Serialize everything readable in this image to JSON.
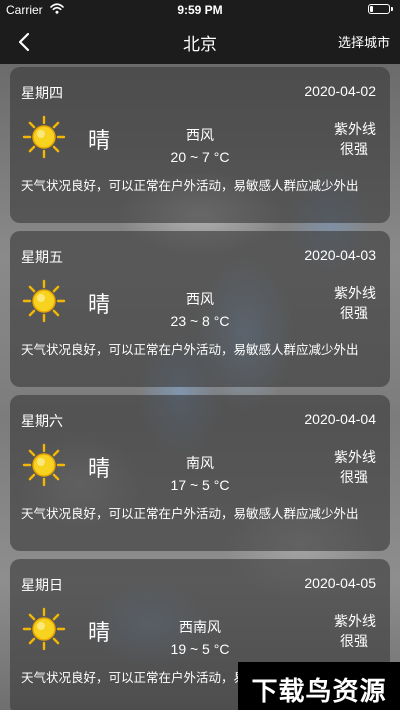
{
  "status_bar": {
    "carrier": "Carrier",
    "time": "9:59 PM"
  },
  "nav": {
    "title": "北京",
    "back_icon": "chevron-left-icon",
    "right_button": "选择城市"
  },
  "forecast": [
    {
      "weekday": "星期四",
      "date": "2020-04-02",
      "icon": "sun-icon",
      "condition": "晴",
      "wind": "西风",
      "temp": "20 ~ 7 °C",
      "uv_label": "紫外线",
      "uv_value": "很强",
      "description": "天气状况良好，可以正常在户外活动，易敏感人群应减少外出"
    },
    {
      "weekday": "星期五",
      "date": "2020-04-03",
      "icon": "sun-icon",
      "condition": "晴",
      "wind": "西风",
      "temp": "23 ~ 8 °C",
      "uv_label": "紫外线",
      "uv_value": "很强",
      "description": "天气状况良好，可以正常在户外活动，易敏感人群应减少外出"
    },
    {
      "weekday": "星期六",
      "date": "2020-04-04",
      "icon": "sun-icon",
      "condition": "晴",
      "wind": "南风",
      "temp": "17 ~ 5 °C",
      "uv_label": "紫外线",
      "uv_value": "很强",
      "description": "天气状况良好，可以正常在户外活动，易敏感人群应减少外出"
    },
    {
      "weekday": "星期日",
      "date": "2020-04-05",
      "icon": "sun-icon",
      "condition": "晴",
      "wind": "西南风",
      "temp": "19 ~ 5 °C",
      "uv_label": "紫外线",
      "uv_value": "很强",
      "description": "天气状况良好，可以正常在户外活动，易敏感人群应减少外出"
    }
  ],
  "watermark": {
    "text": "下载鸟资源"
  },
  "colors": {
    "bar_background": "#1c1c1c",
    "card_background": "rgba(58,58,58,0.62)",
    "sun_core": "#f7d21f",
    "text": "#ffffff"
  }
}
